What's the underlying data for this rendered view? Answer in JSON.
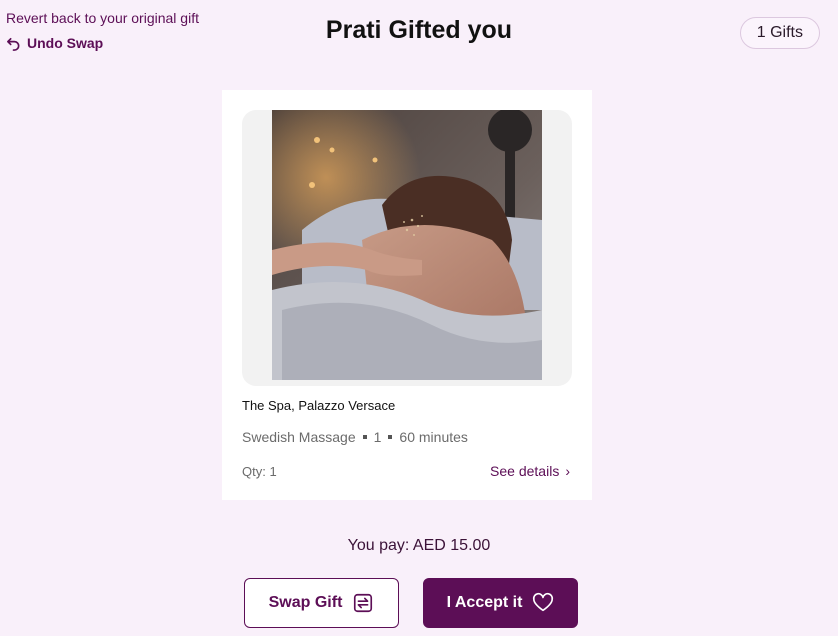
{
  "header": {
    "revert_hint": "Revert back to your original gift",
    "undo_label": "Undo Swap",
    "title": "Prati Gifted you",
    "gifts_count": "1 Gifts"
  },
  "gift": {
    "image_icon": "spa-massage-photo",
    "vendor": "The Spa, Palazzo Versace",
    "service": "Swedish Massage",
    "count": "1",
    "duration": "60 minutes",
    "qty": "Qty: 1",
    "see_details": "See details",
    "chevron": "›"
  },
  "payment": {
    "label": "You pay: AED 15.00"
  },
  "actions": {
    "swap_label": "Swap Gift",
    "accept_label": "I Accept it"
  },
  "colors": {
    "brand": "#5c0e56",
    "background": "#f9f0fa"
  }
}
